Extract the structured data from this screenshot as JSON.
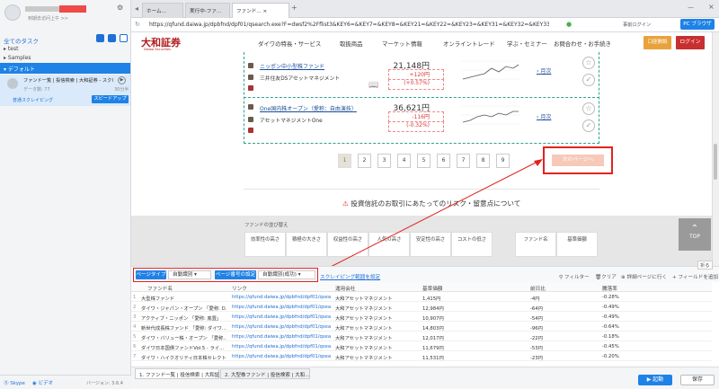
{
  "left": {
    "user_tag": "到期去访问上午 >>",
    "tasks_title": "全てのタスク",
    "tree": [
      "test",
      "Samples"
    ],
    "default_folder": "デフォルト",
    "task": {
      "title": "ファンド一覧 | 投信検索 | 大和証券 - スクレイ...",
      "sub": "データ数: 77",
      "count": "30分半",
      "speed_label": "スピードアップ",
      "scraping_link": "普通スクレイピング"
    },
    "footer": {
      "skype": "Skype",
      "video": "ビデオ",
      "version": "バージョン: 3.6.4"
    }
  },
  "browser": {
    "tabs": [
      "ホーム...",
      "実行中-ファ...",
      "ファンド..."
    ],
    "url": "https://qfund.daiwa.jp/dpbfnd/dpf01/qsearch.exe?F=dwsf2%2Fflist3&KEY6=&KEY7=&KEY8=&KEY21=&KEY22=&KEY23=&KEY31=&KEY32=&KEY33=%8A%94...",
    "prior_login": "事前ログイン",
    "pc_browser": "PC ブラウザ"
  },
  "site": {
    "logo": "大和証券",
    "logo_sub": "Daiwa Securities",
    "nav": [
      "ダイワの特長・サービス",
      "取扱商品",
      "マーケット情報",
      "オンライントレード",
      "学ぶ・セミナー",
      "お問合わせ・お手続き"
    ],
    "account_btn": "口座開設",
    "login_btn": "ログイン",
    "funds": [
      {
        "name": "ニッポン中小型株ファンド",
        "manager": "三井住友DSアセットマネジメント",
        "price": "21,148円",
        "change": "+120円",
        "pct": "(+0.57%)",
        "detail": "月次"
      },
      {
        "name": "One国内株オープン（愛称：自由演技）",
        "manager": "アセットマネジメントOne",
        "price": "36,621円",
        "change": "-116円",
        "pct": "(-0.32%)",
        "detail": "月次"
      }
    ],
    "pages": [
      "1",
      "2",
      "3",
      "4",
      "5",
      "6",
      "7",
      "8",
      "9"
    ],
    "next_page": "次のページへ",
    "risk_text": "投資信託のお取引にあたってのリスク・留意点について",
    "sort_title": "ファンドの並び替え",
    "sort_cells": [
      "効率性の高さ",
      "積極の大きさ",
      "収益性の高さ",
      "人気の高さ",
      "安定性の高さ",
      "コストの低さ",
      "ファンド名",
      "基準価額"
    ],
    "top_btn": "TOP"
  },
  "controls": {
    "page_type_label": "ページタイプ",
    "page_type_value": "自動識別",
    "page_num_label": "ページ番号の設定",
    "page_num_value": "自動識別(成功)",
    "scrape_range": "スクレイピング範囲を設定",
    "filter": "フィルター",
    "clear": "クリア",
    "goto_detail": "詳細ページに行く",
    "add_field": "フィールドを追加",
    "fold": "折る"
  },
  "table": {
    "headers": [
      "ファンド名",
      "リンク",
      "運用会社",
      "基準価額",
      "前日比",
      "騰落率"
    ],
    "rows": [
      [
        "大型株ファンド",
        "https://qfund.daiwa.jp/dpbfnd/dpf01/qsearch...",
        "大和アセットマネジメント",
        "1,415円",
        "-4円",
        "-0.28%"
      ],
      [
        "ダイワ・ジャパン・オープン 「愛称: D...",
        "https://qfund.daiwa.jp/dpbfnd/dpf01/qsearch...",
        "大和アセットマネジメント",
        "12,984円",
        "-64円",
        "-0.49%"
      ],
      [
        "アクティブ・ニッポン 「愛称: 底豊」",
        "https://qfund.daiwa.jp/dpbfnd/dpf01/qsearch...",
        "大和アセットマネジメント",
        "10,907円",
        "-54円",
        "-0.49%"
      ],
      [
        "新世代成長株ファンド 「愛称: ダイワ...",
        "https://qfund.daiwa.jp/dpbfnd/dpf01/qsearch...",
        "大和アセットマネジメント",
        "14,803円",
        "-96円",
        "-0.64%"
      ],
      [
        "ダイワ・バリュー株・オープン 「愛称...",
        "https://qfund.daiwa.jp/dpbfnd/dpf01/qsearch...",
        "大和アセットマネジメント",
        "12,017円",
        "-22円",
        "-0.18%"
      ],
      [
        "ダイワ日本国債ファンドVol.5 - ライ...",
        "https://qfund.daiwa.jp/dpbfnd/dpf01/qsearch...",
        "大和アセットマネジメント",
        "11,679円",
        "-53円",
        "-0.45%"
      ],
      [
        "ダイワ・ハイクオリティ日本株セレクト...",
        "https://qfund.daiwa.jp/dpbfnd/dpf01/qsearch...",
        "大和アセットマネジメント",
        "11,531円",
        "-23円",
        "-0.20%"
      ]
    ]
  },
  "bottom": {
    "tabs": [
      "1. ファンド一覧 | 投信検索 | 大和証...",
      "2. 大型株ファンド | 投信検索 | 大和..."
    ],
    "run": "▶ 起動",
    "save": "保存"
  }
}
